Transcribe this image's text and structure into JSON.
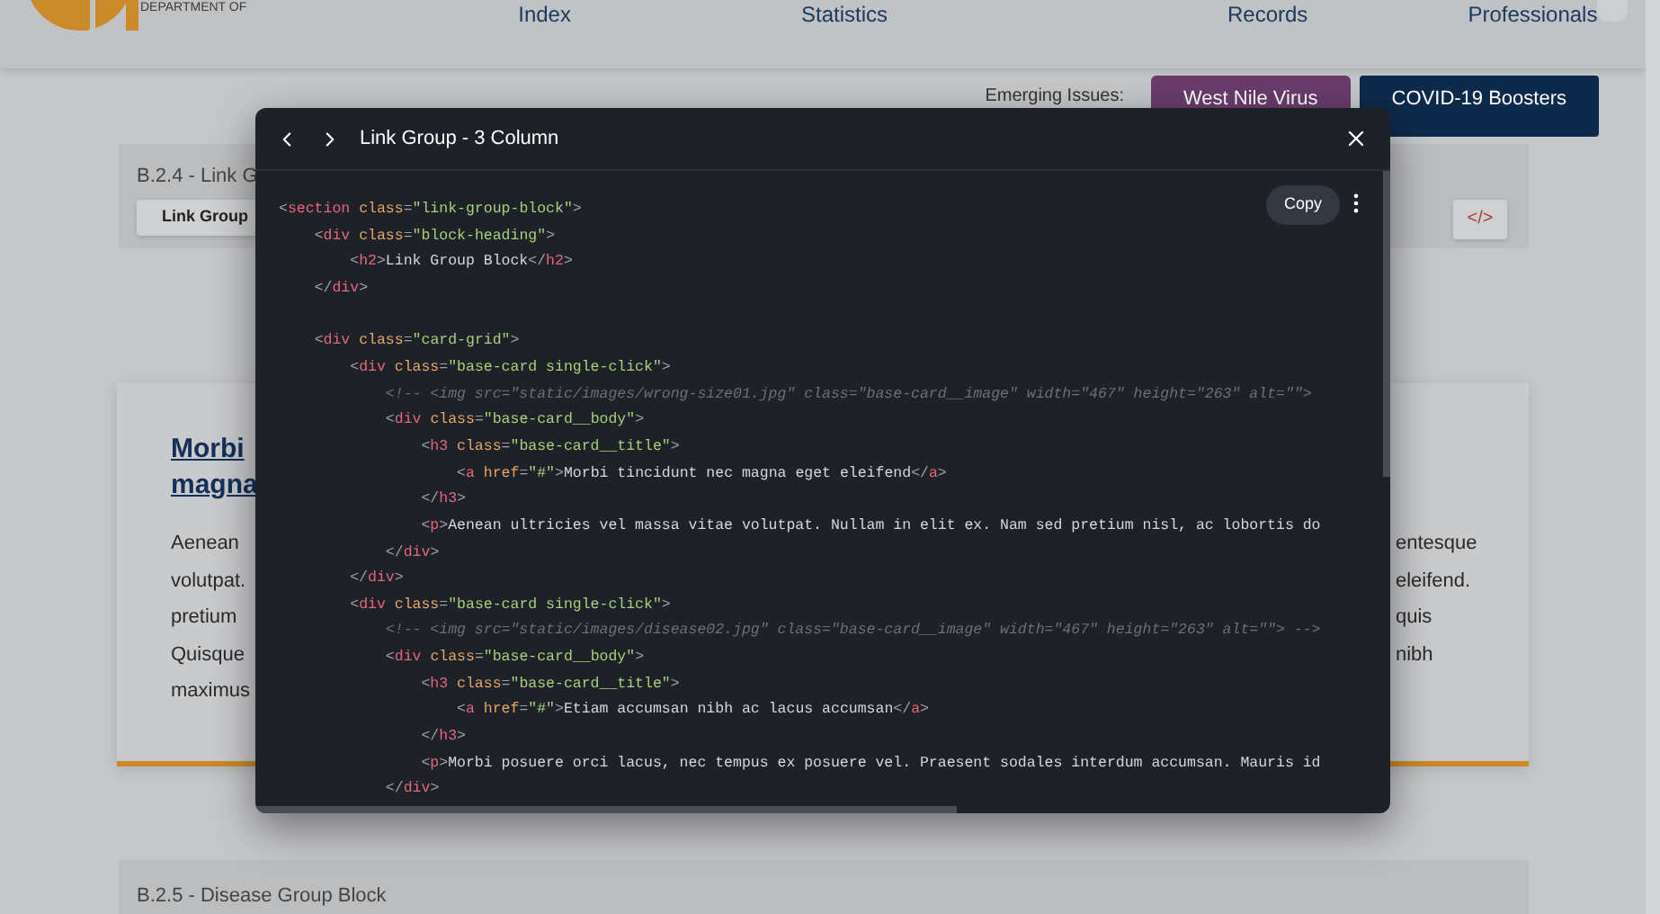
{
  "header": {
    "logo_text": "DEPARTMENT OF",
    "nav": [
      "Index",
      "Statistics",
      "Records",
      "Professionals"
    ]
  },
  "emerging": {
    "label": "Emerging Issues:",
    "buttons": [
      {
        "label": "West Nile Virus",
        "color": "#6a3c6c"
      },
      {
        "label": "COVID-19 Boosters",
        "color": "#0e2a4b"
      }
    ]
  },
  "section_b24": {
    "title": "B.2.4 - Link G",
    "button": "Link Group",
    "code_button": "</>"
  },
  "card": {
    "title_lines": [
      "Morbi",
      "magna"
    ],
    "left_lines": [
      "Aenean",
      "volutpat.",
      "pretium",
      "Quisque",
      "maximus"
    ],
    "right_lines": [
      "entesque",
      "eleifend.",
      "quis",
      "nibh"
    ]
  },
  "section_b25": {
    "title": "B.2.5 - Disease Group Block"
  },
  "modal": {
    "title": "Link Group - 3 Column",
    "copy": "Copy",
    "code_blocks": [
      [
        "<section class=\"link-group-block\">",
        "    <div class=\"block-heading\">",
        "        <h2>Link Group Block</h2>",
        "    </div>"
      ],
      [
        "    <div class=\"card-grid\">",
        "        <div class=\"base-card single-click\">",
        "            <!-- <img src=\"static/images/wrong-size01.jpg\" class=\"base-card__image\" width=\"467\" height=\"263\" alt=\"\">",
        "            <div class=\"base-card__body\">",
        "                <h3 class=\"base-card__title\">",
        "                    <a href=\"#\">Morbi tincidunt nec magna eget eleifend</a>",
        "                </h3>",
        "                <p>Aenean ultricies vel massa vitae volutpat. Nullam in elit ex. Nam sed pretium nisl, ac lobortis do",
        "            </div>",
        "        </div>",
        "        <div class=\"base-card single-click\">",
        "            <!-- <img src=\"static/images/disease02.jpg\" class=\"base-card__image\" width=\"467\" height=\"263\" alt=\"\"> -->",
        "            <div class=\"base-card__body\">",
        "                <h3 class=\"base-card__title\">",
        "                    <a href=\"#\">Etiam accumsan nibh ac lacus accumsan</a>",
        "                </h3>",
        "                <p>Morbi posuere orci lacus, nec tempus ex posuere vel. Praesent sodales interdum accumsan. Mauris id",
        "            </div>"
      ]
    ]
  }
}
